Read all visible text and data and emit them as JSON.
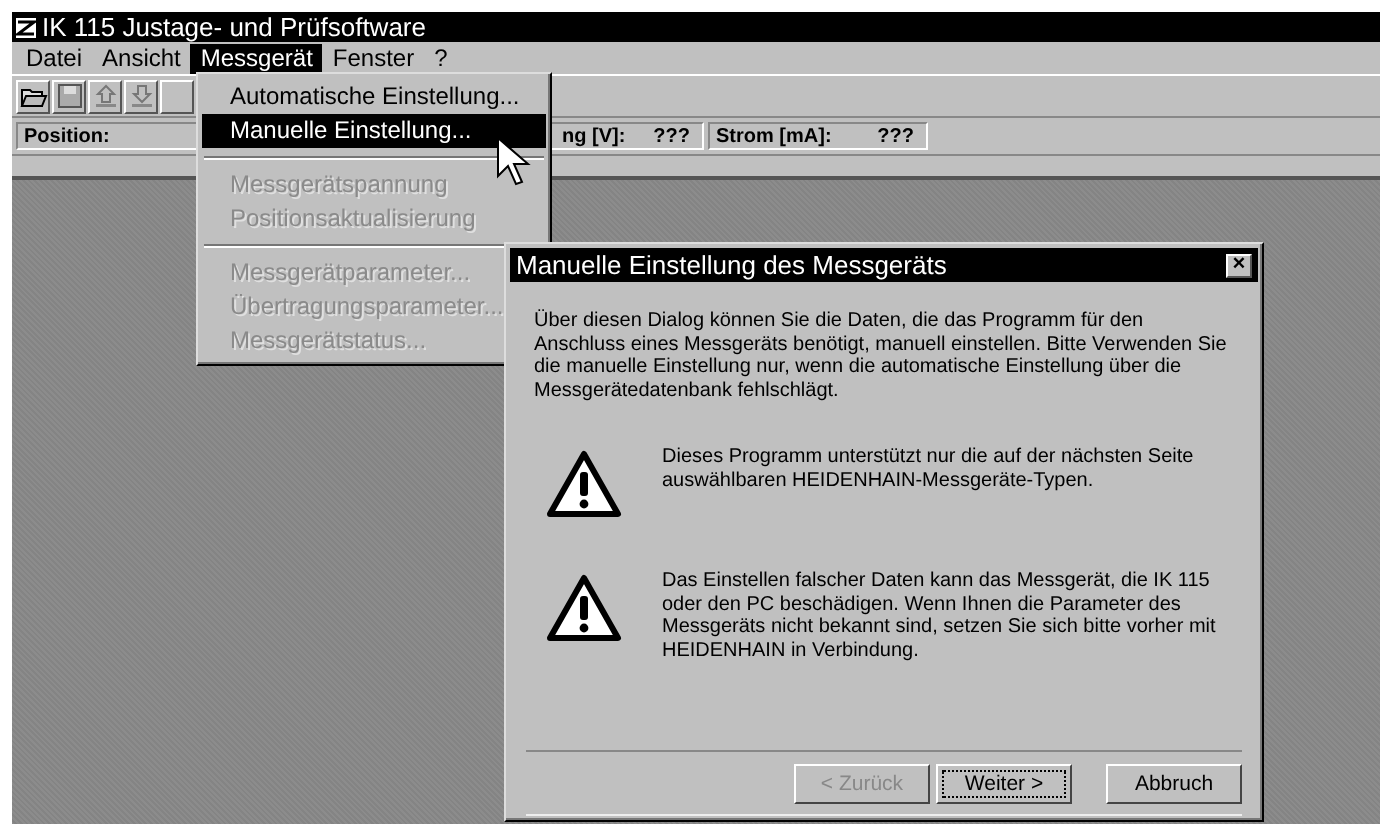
{
  "window": {
    "title": "IK 115 Justage- und Prüfsoftware"
  },
  "menu_bar": [
    {
      "label": "Datei",
      "selected": false
    },
    {
      "label": "Ansicht",
      "selected": false
    },
    {
      "label": "Messgerät",
      "selected": true
    },
    {
      "label": "Fenster",
      "selected": false
    },
    {
      "label": "?",
      "selected": false
    }
  ],
  "status_fields": [
    {
      "label": "Position:"
    },
    {
      "label": "ng [V]:",
      "value": "???"
    },
    {
      "label": "Strom [mA]:",
      "value": "???"
    }
  ],
  "dropdown": [
    {
      "kind": "item",
      "label": "Automatische Einstellung...",
      "disabled": false,
      "selected": false
    },
    {
      "kind": "item",
      "label": "Manuelle Einstellung...",
      "disabled": false,
      "selected": true
    },
    {
      "kind": "separator"
    },
    {
      "kind": "item",
      "label": "Messgerätspannung",
      "disabled": true,
      "selected": false
    },
    {
      "kind": "item",
      "label": "Positionsaktualisierung",
      "disabled": true,
      "selected": false
    },
    {
      "kind": "separator"
    },
    {
      "kind": "item",
      "label": "Messgerätparameter...",
      "disabled": true,
      "selected": false
    },
    {
      "kind": "item",
      "label": "Übertragungsparameter...",
      "disabled": true,
      "selected": false
    },
    {
      "kind": "item",
      "label": "Messgerätstatus...",
      "disabled": true,
      "selected": false
    }
  ],
  "dialog": {
    "title": "Manuelle Einstellung des Messgeräts",
    "close": "×",
    "intro": "Über diesen Dialog können Sie die Daten, die das Programm für den Anschluss eines Messgeräts benötigt, manuell einstellen. Bitte Verwenden Sie die manuelle Einstellung nur, wenn die automatische Einstellung über die Messgerätedatenbank fehlschlägt.",
    "warnings": [
      "Dieses Programm unterstützt nur die auf der nächsten Seite auswählbaren HEIDENHAIN-Messgeräte-Typen.",
      "Das Einstellen falscher Daten kann das Messgerät, die IK 115 oder den PC beschädigen. Wenn Ihnen die Parameter des Messgeräts nicht bekannt sind, setzen Sie sich bitte vorher mit HEIDENHAIN in Verbindung."
    ],
    "buttons": [
      {
        "label": "< Zurück",
        "disabled": true,
        "default": false
      },
      {
        "label": "Weiter >",
        "disabled": false,
        "default": true
      },
      {
        "label": "Abbruch",
        "disabled": false,
        "default": false
      }
    ]
  }
}
